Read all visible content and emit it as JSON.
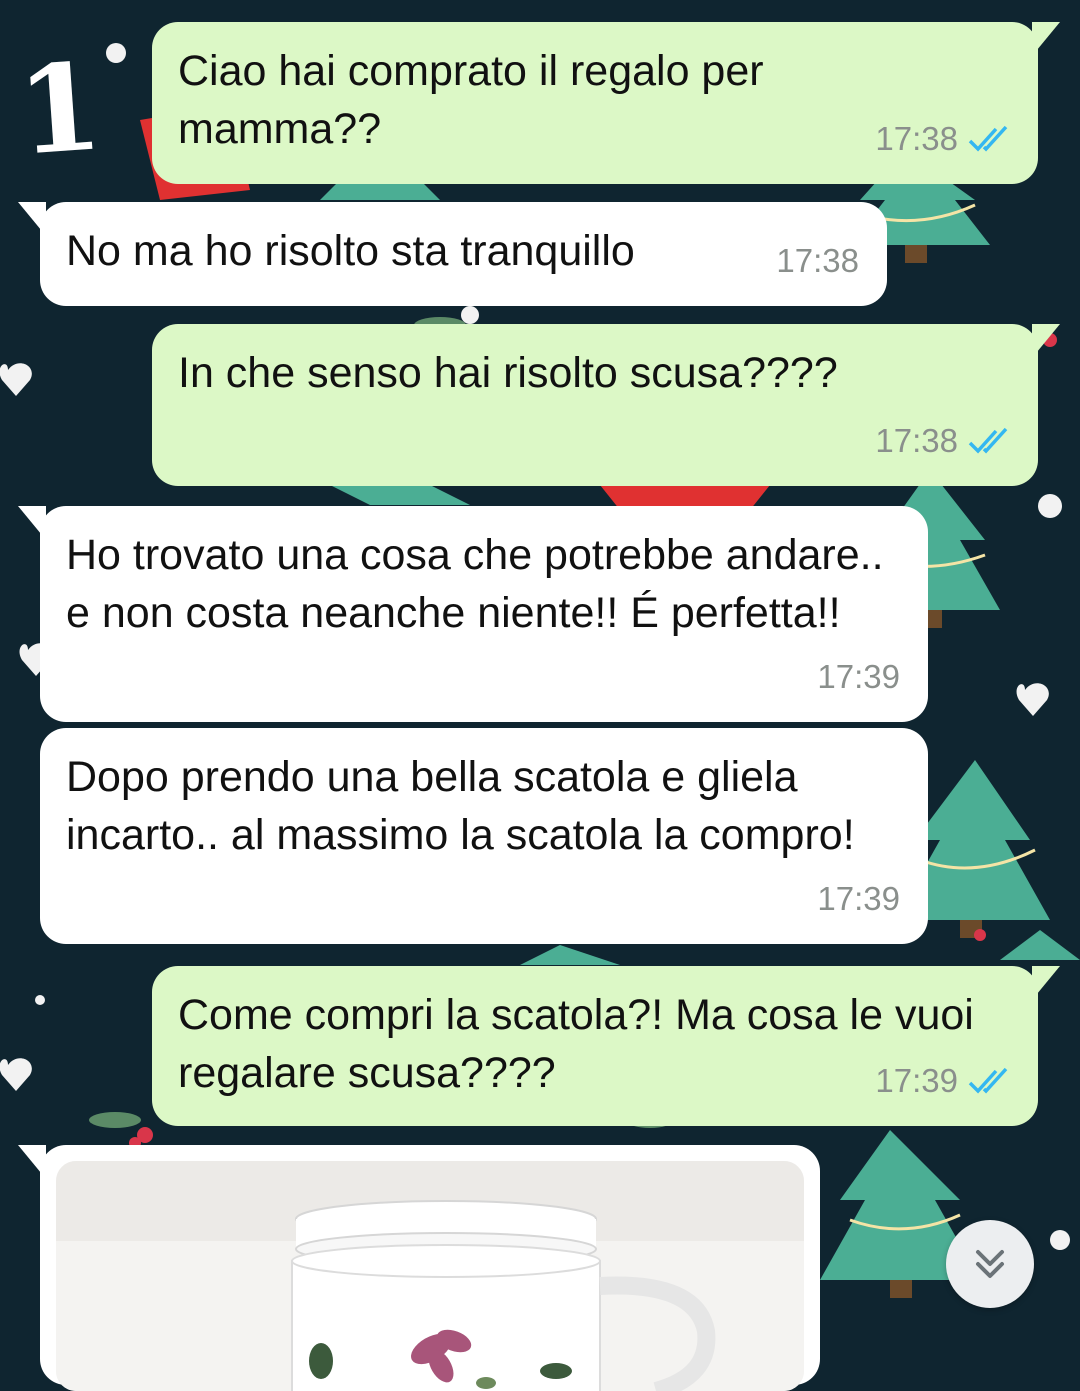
{
  "annotation": {
    "number": "1"
  },
  "messages": [
    {
      "dir": "out",
      "text": "Ciao hai comprato il regalo per mamma??",
      "time": "17:38",
      "read": true
    },
    {
      "dir": "in",
      "text": "No ma ho risolto sta tranquillo",
      "time": "17:38"
    },
    {
      "dir": "out",
      "text": "In che senso hai risolto scusa????",
      "time": "17:38",
      "read": true
    },
    {
      "dir": "in",
      "text": "Ho trovato una cosa che potrebbe andare.. e non costa neanche niente!! É perfetta!!",
      "time": "17:39"
    },
    {
      "dir": "in",
      "text": "Dopo prendo una bella scatola e gliela incarto.. al massimo la scatola la compro!",
      "time": "17:39"
    },
    {
      "dir": "out",
      "text": "Come compri la scatola?! Ma cosa le vuoi regalare scusa????",
      "time": "17:39",
      "read": true
    }
  ],
  "photo": {
    "content": "white tea mug with lid and pink flower pattern"
  },
  "icons": {
    "read_receipt": "double-check-icon",
    "scroll_down": "chevrons-down-icon"
  },
  "colors": {
    "outgoing_bubble": "#dcf8c6",
    "incoming_bubble": "#ffffff",
    "read_tick": "#34b7f1",
    "wallpaper": "#0f2530"
  }
}
